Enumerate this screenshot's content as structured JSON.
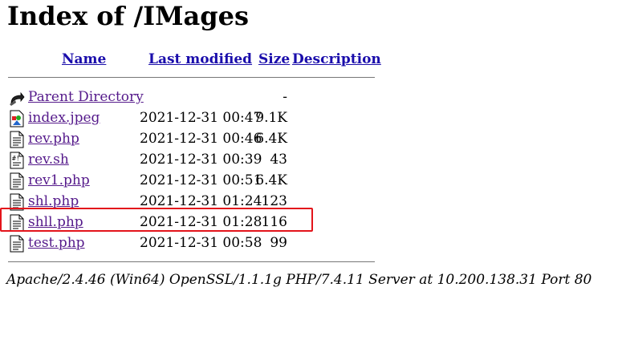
{
  "page_title": "Index of /IMages",
  "columns": {
    "name": "Name",
    "last_modified": "Last modified",
    "size": "Size",
    "description": "Description"
  },
  "entries": [
    {
      "name": "Parent Directory",
      "modified": "",
      "size": "-",
      "icon": "parent-directory-icon"
    },
    {
      "name": "index.jpeg",
      "modified": "2021-12-31 00:47",
      "size": "9.1K",
      "icon": "image-file-icon"
    },
    {
      "name": "rev.php",
      "modified": "2021-12-31 00:46",
      "size": "6.4K",
      "icon": "text-file-icon"
    },
    {
      "name": "rev.sh",
      "modified": "2021-12-31 00:39",
      "size": "43",
      "icon": "script-file-icon"
    },
    {
      "name": "rev1.php",
      "modified": "2021-12-31 00:51",
      "size": "6.4K",
      "icon": "text-file-icon"
    },
    {
      "name": "shl.php",
      "modified": "2021-12-31 01:24",
      "size": "123",
      "icon": "text-file-icon"
    },
    {
      "name": "shll.php",
      "modified": "2021-12-31 01:28",
      "size": "116",
      "icon": "text-file-icon"
    },
    {
      "name": "test.php",
      "modified": "2021-12-31 00:58",
      "size": "99",
      "icon": "text-file-icon"
    }
  ],
  "highlighted_entry": "shll.php",
  "colors": {
    "link": "#551a8b",
    "highlight": "#e3141b"
  },
  "server_signature": "Apache/2.4.46 (Win64) OpenSSL/1.1.1g PHP/7.4.11 Server at 10.200.138.31 Port 80"
}
